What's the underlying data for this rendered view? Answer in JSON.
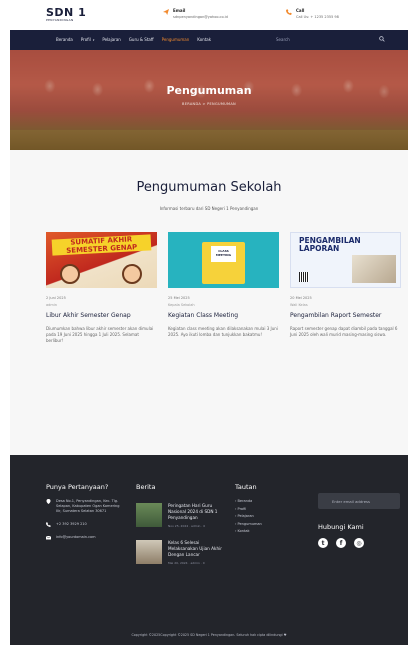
{
  "logo": {
    "main": "SDN 1",
    "sub": "PENYANDINGAN"
  },
  "header": {
    "email_label": "Email",
    "email_value": "sdnpenyandingan@yahoo.co.id",
    "call_label": "Call",
    "call_value": "Call Us: + 1235 2355 98"
  },
  "nav": {
    "items": [
      "Beranda",
      "Profil",
      "Pelajaran",
      "Guru & Staff",
      "Pengumuman",
      "Kontak"
    ],
    "active": "Pengumuman",
    "search_placeholder": "Search"
  },
  "hero": {
    "title": "Pengumuman",
    "breadcrumb": "BERANDA > PENGUMUMAN"
  },
  "section": {
    "title": "Pengumuman Sekolah",
    "subtitle": "Informasi terbaru dari SD Negeri 1 Penyandingan"
  },
  "cards": [
    {
      "thumb_title": "SUMATIF AKHIR SEMESTER GENAP",
      "date": "2 Juni 2025",
      "author": "admin",
      "title": "Libur Akhir Semester Genap",
      "text": "Diumumkan bahwa libur akhir semester akan dimulai pada 19 Juni 2025 hingga 1 Juli 2025. Selamat berlibur!"
    },
    {
      "thumb_title": "CLASS MEETING",
      "date": "25 Mei 2025",
      "author": "Kepala Sekolah",
      "title": "Kegiatan Class Meeting",
      "text": "Kegiatan class meeting akan dilaksanakan mulai 3 Juni 2025. Ayo ikuti lomba dan tunjukkan bakatmu!"
    },
    {
      "thumb_title": "PENGAMBILAN LAPORAN",
      "date": "20 Mei 2025",
      "author": "Wali Kelas",
      "title": "Pengambilan Raport Semester",
      "text": "Raport semester genap dapat diambil pada tanggal 6 Juni 2025 oleh wali murid masing-masing siswa."
    }
  ],
  "footer": {
    "questions_title": "Punya Pertanyaan?",
    "address": "Desa No.1, Penyandingan, Kec. Tlg. Selapan, Kabupaten Ogan Komering Ilir, Sumatera Selatan 30671",
    "phone": "+2 392 3929 210",
    "email": "info@yourdomain.com",
    "news_title": "Berita",
    "news": [
      {
        "title": "Peringatan Hari Guru Nasional 2024 di SDN 1 Penyandingan",
        "meta": "Nov 25, 2024 · admin · 0"
      },
      {
        "title": "Kelas 6 Selesai Melaksanakan Ujian Akhir Dengan Lancar",
        "meta": "Mei 20, 2024 · admin · 0"
      }
    ],
    "links_title": "Tautan",
    "links": [
      "Beranda",
      "Profil",
      "Pelajaran",
      "Pengumuman",
      "Kontak"
    ],
    "email_placeholder": "Enter email address",
    "social_title": "Hubungi Kami",
    "social_icons": [
      "twitter-icon",
      "facebook-icon",
      "instagram-icon"
    ],
    "copyright": "Copyright ©2025Copyright ©2025 SD Negeri 1 Penyandingan. Seluruh hak cipta dilindungi ♥"
  }
}
